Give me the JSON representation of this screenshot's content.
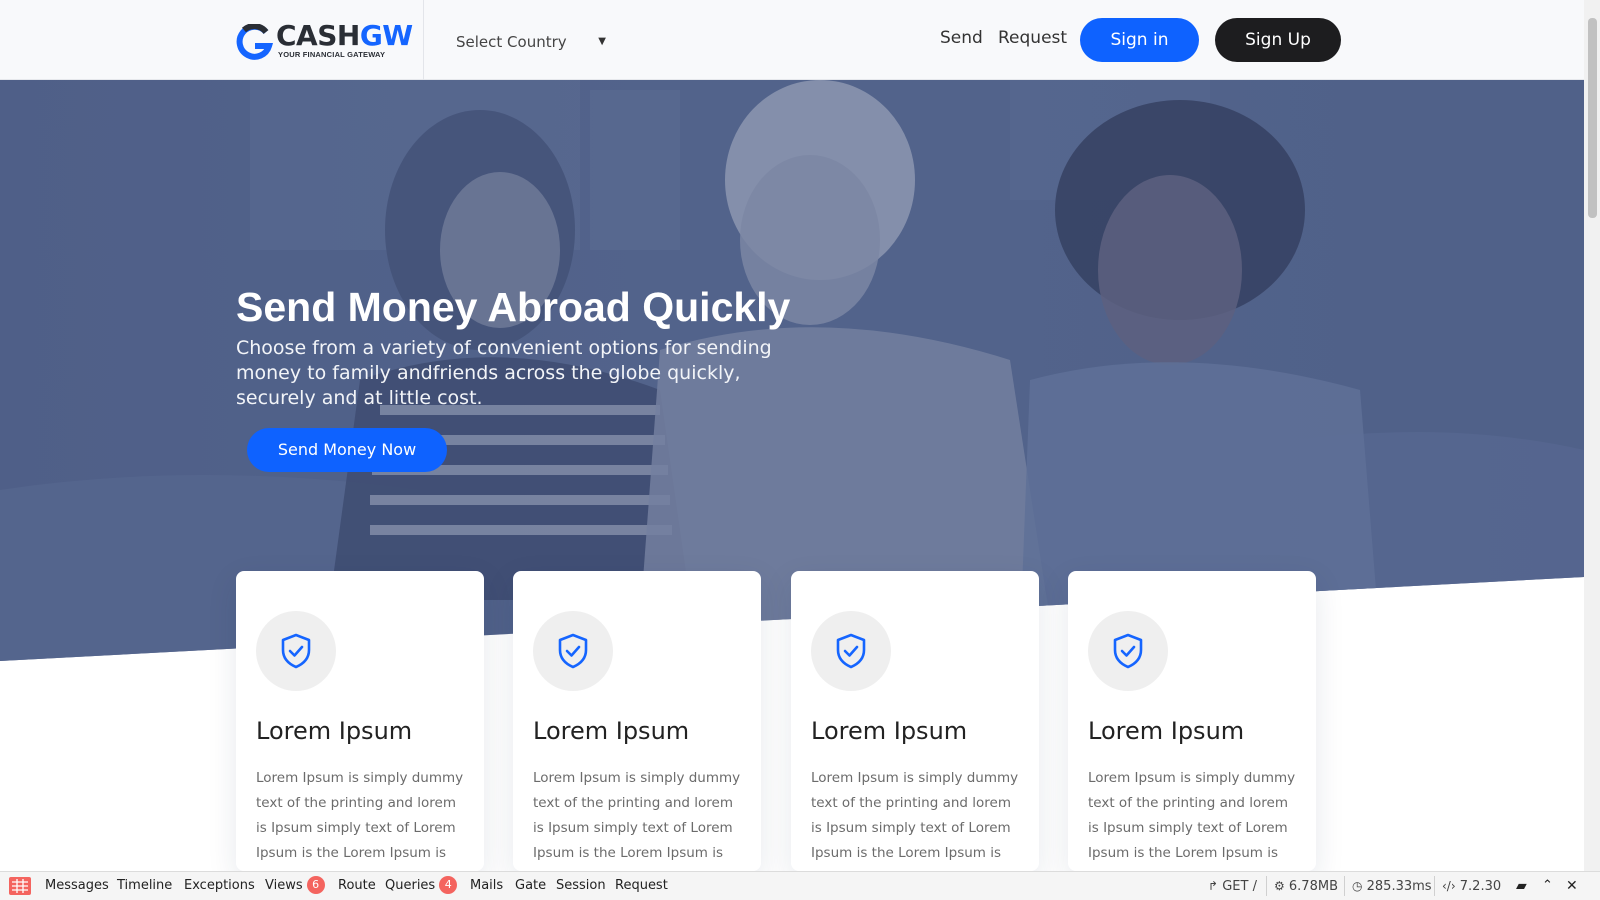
{
  "header": {
    "logo_word_a": "CASH",
    "logo_word_b": "GW",
    "logo_tagline": "YOUR FINANCIAL GATEWAY",
    "country_select_value": "Select Country",
    "nav": {
      "send": "Send",
      "request": "Request"
    },
    "sign_in": "Sign in",
    "sign_up": "Sign Up"
  },
  "hero": {
    "title": "Send Money Abroad Quickly",
    "subtitle": "Choose from a variety of convenient options for sending money to family andfriends across the globe quickly, securely and at little cost.",
    "cta": "Send Money Now"
  },
  "cards": [
    {
      "title": "Lorem Ipsum",
      "text": "Lorem Ipsum is simply dummy text of the printing and lorem is Ipsum simply text of Lorem Ipsum is the Lorem Ipsum is",
      "icon": "shield-check-icon"
    },
    {
      "title": "Lorem Ipsum",
      "text": "Lorem Ipsum is simply dummy text of the printing and lorem is Ipsum simply text of Lorem Ipsum is the Lorem Ipsum is",
      "icon": "shield-check-icon"
    },
    {
      "title": "Lorem Ipsum",
      "text": "Lorem Ipsum is simply dummy text of the printing and lorem is Ipsum simply text of Lorem Ipsum is the Lorem Ipsum is",
      "icon": "shield-check-icon"
    },
    {
      "title": "Lorem Ipsum",
      "text": "Lorem Ipsum is simply dummy text of the printing and lorem is Ipsum simply text of Lorem Ipsum is the Lorem Ipsum is",
      "icon": "shield-check-icon"
    }
  ],
  "debugbar": {
    "tabs": {
      "messages": "Messages",
      "timeline": "Timeline",
      "exceptions": "Exceptions",
      "views": "Views",
      "views_count": "6",
      "route": "Route",
      "queries": "Queries",
      "queries_count": "4",
      "mails": "Mails",
      "gate": "Gate",
      "session": "Session",
      "request": "Request"
    },
    "method": "GET",
    "path": "/",
    "memory": "6.78MB",
    "time": "285.33ms",
    "php_version": "7.2.30"
  },
  "colors": {
    "primary": "#0e62ff",
    "dark_button": "#1d1d1f",
    "hero_overlay": "#4f6088",
    "badge": "#f4645f"
  }
}
